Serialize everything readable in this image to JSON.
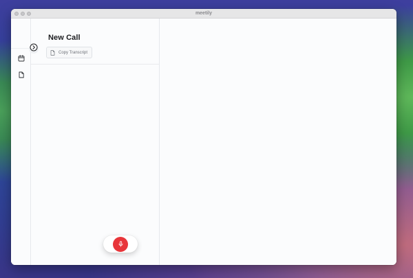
{
  "window": {
    "title": "meetily"
  },
  "rail": {
    "items": [
      {
        "icon": "calendar-icon"
      },
      {
        "icon": "document-icon"
      }
    ],
    "toggle_icon": "chevron-right-circle-icon"
  },
  "sidebar": {
    "title": "New Call",
    "copy_button_label": "Copy Transcript",
    "copy_button_icon": "document-icon"
  },
  "record": {
    "icon": "microphone-icon",
    "color": "#e8353a"
  },
  "colors": {
    "accent_red": "#e8353a",
    "window_bg": "#fbfcfd",
    "titlebar_bg": "#e6e6e7"
  }
}
